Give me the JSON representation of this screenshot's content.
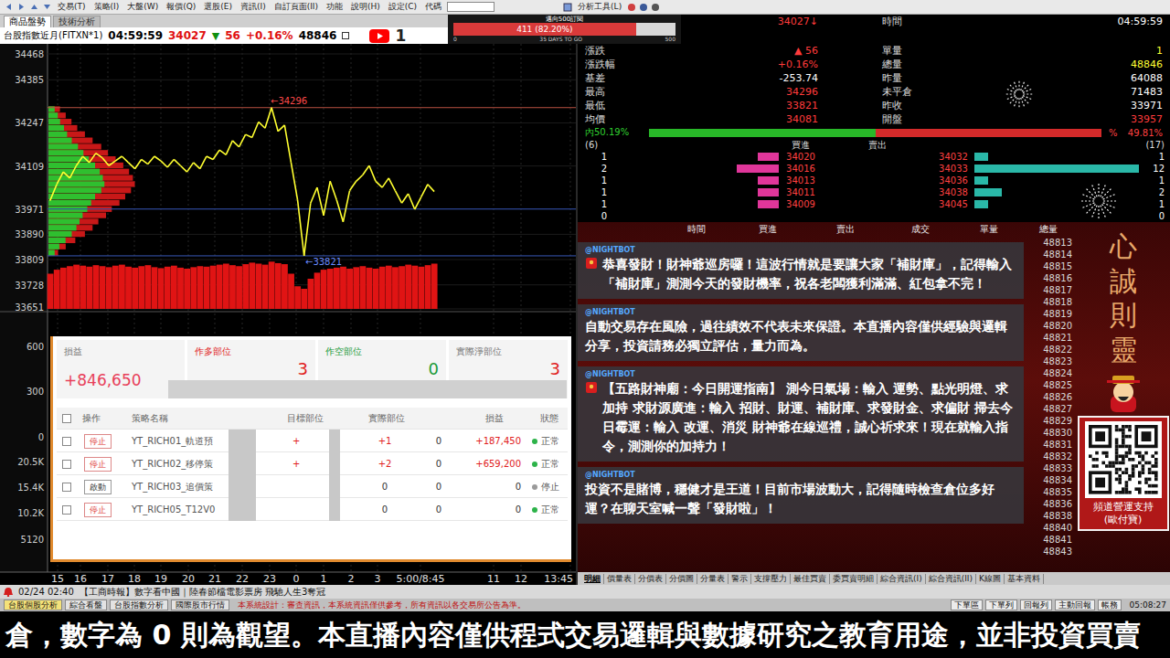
{
  "toolbar": {
    "menus": [
      "交易(T)",
      "策略(I)",
      "大盤(W)",
      "報價(Q)",
      "選股(E)",
      "資訊(I)",
      "自訂頁面(II)",
      "功能",
      "說明(H)",
      "設定(C)"
    ],
    "code_label": "代碼",
    "tool_menu": "分析工具(L)"
  },
  "subscribe_goal": {
    "title": "邁向500訂閱",
    "text": "411 (82.20%)",
    "level": 0.822,
    "min": "0",
    "mid": "35 DAYS TO GO",
    "max": "500"
  },
  "left_panel": {
    "tabs": [
      {
        "label": "商品盤勢",
        "selected": true
      },
      {
        "label": "技術分析",
        "selected": false
      }
    ],
    "quote_line": {
      "symbol": "台股指數近月(FITXN*1)",
      "time": "04:59:59",
      "price": "34027",
      "arrow": "▼",
      "change": "56",
      "pct": "+0.16%",
      "volume": "48846"
    },
    "youtube_count": "1"
  },
  "price_chart": {
    "y_max": 34468,
    "y_min": 33651,
    "y_ticks": [
      "34468",
      "34385",
      "34247",
      "34109",
      "33971",
      "33890",
      "33809",
      "33728",
      "33651"
    ],
    "series": [
      34000,
      34050,
      34090,
      34070,
      34110,
      34140,
      34120,
      34150,
      34135,
      34110,
      34125,
      34140,
      34120,
      34100,
      34130,
      34115,
      34140,
      34125,
      34105,
      34130,
      34110,
      34090,
      34120,
      34100,
      34140,
      34130,
      34160,
      34145,
      34190,
      34170,
      34210,
      34200,
      34250,
      34230,
      34296,
      34220,
      34240,
      34120,
      34000,
      33821,
      33990,
      34040,
      33950,
      34060,
      34000,
      33930,
      34030,
      34060,
      34080,
      34110,
      34060,
      34040,
      34070,
      34030,
      33990,
      34020,
      33970,
      34010,
      34050,
      34027
    ],
    "high_marker": {
      "label": "←34296",
      "value": 34296
    },
    "low_marker": {
      "label": "←33821",
      "value": 33821
    },
    "ref_line": 33971,
    "volume_profile": {
      "start": 34290,
      "step": 20,
      "buy": [
        8,
        12,
        15,
        20,
        24,
        30,
        38,
        45,
        52,
        60,
        66,
        70,
        72,
        68,
        60,
        55,
        50,
        44,
        40,
        36,
        30,
        22,
        14,
        8
      ],
      "sell": [
        12,
        18,
        24,
        30,
        38,
        46,
        55,
        62,
        70,
        78,
        84,
        88,
        90,
        86,
        80,
        74,
        66,
        60,
        52,
        46,
        38,
        28,
        18,
        10
      ]
    },
    "volume_bars": [
      70,
      78,
      82,
      85,
      88,
      86,
      84,
      87,
      85,
      83,
      86,
      88,
      84,
      82,
      85,
      87,
      83,
      81,
      84,
      86,
      82,
      80,
      83,
      85,
      84,
      86,
      88,
      90,
      87,
      85,
      89,
      92,
      90,
      88,
      94,
      91,
      89,
      70,
      45,
      40,
      60,
      72,
      78,
      80,
      82,
      84,
      80,
      83,
      85,
      82,
      80,
      84,
      86,
      83,
      85,
      88,
      86,
      84,
      87,
      90
    ]
  },
  "lower_chart": {
    "y_ticks": [
      "600",
      "300",
      "0",
      "20.5K",
      "15.4K",
      "10.2K",
      "5120"
    ]
  },
  "x_axis": [
    "15",
    "16",
    "17",
    "18",
    "19",
    "20",
    "21",
    "22",
    "23",
    "0",
    "1",
    "2",
    "3",
    "5:00/8:45",
    "11",
    "12",
    "13:45"
  ],
  "strategy_panel": {
    "summary": [
      {
        "label": "損益",
        "value": "+846,650",
        "color": "#e8405a",
        "label_color": "#777777"
      },
      {
        "label": "作多部位",
        "value": "3",
        "color": "#e02020",
        "label_color": "#e02020"
      },
      {
        "label": "作空部位",
        "value": "0",
        "color": "#1a9a3a",
        "label_color": "#1a9a3a"
      },
      {
        "label": "實際淨部位",
        "value": "3",
        "color": "#e02020",
        "label_color": "#777777"
      }
    ],
    "header_checked": false,
    "columns": [
      "",
      "操作",
      "策略名稱",
      "目標部位",
      "實際部位",
      "",
      "損益",
      "狀態"
    ],
    "rows": [
      {
        "checked": false,
        "kind": "stop",
        "action": "停止",
        "name": "YT_RICH01_軌道預",
        "target": "+",
        "actual": "+1",
        "extra": "0",
        "pnl": "+187,450",
        "status": "正常",
        "color": "#2db34a"
      },
      {
        "checked": false,
        "kind": "stop",
        "action": "停止",
        "name": "YT_RICH02_移停策",
        "target": "+",
        "actual": "+2",
        "extra": "0",
        "pnl": "+659,200",
        "status": "正常",
        "color": "#2db34a"
      },
      {
        "checked": false,
        "kind": "start",
        "action": "啟動",
        "name": "YT_RICH03_追價策",
        "target": "",
        "actual": "0",
        "extra": "0",
        "pnl": "0",
        "status": "停止",
        "color": "#9a9a9a"
      },
      {
        "checked": false,
        "kind": "stop",
        "action": "停止",
        "name": "YT_RICH05_T12V0",
        "target": "",
        "actual": "0",
        "extra": "0",
        "pnl": "0",
        "status": "正常",
        "color": "#2db34a"
      }
    ]
  },
  "quote_detail": {
    "left": [
      {
        "label": "",
        "value": "34027↓",
        "color": "#ff3b3b"
      },
      {
        "label": "漲跌",
        "value": "▲ 56",
        "color": "#ff3b3b"
      },
      {
        "label": "漲跌幅",
        "value": "+0.16%",
        "color": "#ff3b3b"
      },
      {
        "label": "基差",
        "value": "-253.74",
        "color": "#ffffff"
      },
      {
        "label": "最高",
        "value": "34296",
        "color": "#ff3b3b"
      },
      {
        "label": "最低",
        "value": "33821",
        "color": "#ff3b3b"
      },
      {
        "label": "均價",
        "value": "34081",
        "color": "#ff3b3b"
      }
    ],
    "right": [
      {
        "label": "時間",
        "value": "04:59:59",
        "color": "#ffffff"
      },
      {
        "label": "單量",
        "value": "1",
        "color": "#ffff33"
      },
      {
        "label": "總量",
        "value": "48846",
        "color": "#ffff33"
      },
      {
        "label": "昨量",
        "value": "64088",
        "color": "#ffffff"
      },
      {
        "label": "未平倉",
        "value": "71483",
        "color": "#ffffff"
      },
      {
        "label": "昨收",
        "value": "33971",
        "color": "#ffffff"
      },
      {
        "label": "開盤",
        "value": "33957",
        "color": "#ff3b3b"
      }
    ]
  },
  "inout": {
    "in_label": "內50.19%",
    "level": 0.5019,
    "pct_mark": "%",
    "out_label": "49.81%"
  },
  "order_book": {
    "bid_count": "(6)",
    "ask_count": "(17)",
    "bid_header": "買進",
    "ask_header": "賣出",
    "rows": [
      {
        "bid_qty": "1",
        "bid_level": 0.5,
        "bid_price": "34020",
        "ask_price": "34032",
        "ask_level": 0.083,
        "ask_qty": "1"
      },
      {
        "bid_qty": "2",
        "bid_level": 1,
        "bid_price": "34016",
        "ask_price": "34033",
        "ask_level": 1,
        "ask_qty": "12"
      },
      {
        "bid_qty": "1",
        "bid_level": 0.5,
        "bid_price": "34013",
        "ask_price": "34036",
        "ask_level": 0.083,
        "ask_qty": "1"
      },
      {
        "bid_qty": "1",
        "bid_level": 0.5,
        "bid_price": "34011",
        "ask_price": "34038",
        "ask_level": 0.167,
        "ask_qty": "2"
      },
      {
        "bid_qty": "1",
        "bid_level": 0.5,
        "bid_price": "34009",
        "ask_price": "34045",
        "ask_level": 0.083,
        "ask_qty": "1"
      }
    ],
    "bid_total": "0",
    "ask_total": "0"
  },
  "tick_table": {
    "columns": [
      "時間",
      "買進",
      "賣出",
      "成交",
      "單量",
      "總量"
    ],
    "totals": [
      "48813",
      "48814",
      "48815",
      "48816",
      "48817",
      "48818",
      "48819",
      "48820",
      "48821",
      "48822",
      "48823",
      "48824",
      "48825",
      "48826",
      "48827",
      "48829",
      "48830",
      "48831",
      "48832",
      "48833",
      "48834",
      "48835",
      "48836",
      "48838",
      "48840",
      "48841",
      "48843"
    ]
  },
  "chat": [
    {
      "author": "@NIGHTBOT",
      "kind": "promo",
      "text": "恭喜發財！財神爺巡房囉！這波行情就是要讓大家「補財庫」，記得輸入「補財庫」測測今天的發財機率，祝各老闆獲利滿滿、紅包拿不完！"
    },
    {
      "author": "@NIGHTBOT",
      "kind": "plain",
      "text": "自動交易存在風險，過往績效不代表未來保證。本直播內容僅供經驗與邏輯分享，投資請務必獨立評估，量力而為。"
    },
    {
      "author": "@NIGHTBOT",
      "kind": "promo",
      "text": "【五路財神廟：今日開運指南】 測今日氣場：輸入 運勢、點光明燈、求加持 求財源廣進：輸入 招財、財運、補財庫、求發財金、求偏財 掃去今日霉運：輸入 改運、消災 財神爺在線巡禮，誠心祈求來！現在就輸入指令，測測你的加持力！"
    },
    {
      "author": "@NIGHTBOT",
      "kind": "plain",
      "text": "投資不是賭博，穩健才是王道！目前市場波動大，記得隨時檢查倉位多好運？在聊天室喊一聲「發財啦」！"
    }
  ],
  "shrine": {
    "text": "心誠則靈"
  },
  "support": {
    "title": "頻道營運支持",
    "sub": "(歐付寶)"
  },
  "panel_tabs": [
    {
      "label": "明細",
      "selected": true
    },
    {
      "label": "價量表",
      "selected": false
    },
    {
      "label": "分價表",
      "selected": false
    },
    {
      "label": "分價圖",
      "selected": false
    },
    {
      "label": "分量表",
      "selected": false
    },
    {
      "label": "警示",
      "selected": false
    },
    {
      "label": "支撐壓力",
      "selected": false
    },
    {
      "label": "最佳買賣",
      "selected": false
    },
    {
      "label": "委買賣明細",
      "selected": false
    },
    {
      "label": "綜合資訊(I)",
      "selected": false
    },
    {
      "label": "綜合資訊(II)",
      "selected": false
    },
    {
      "label": "K線圖",
      "selected": false
    },
    {
      "label": "基本資料",
      "selected": false
    }
  ],
  "news": {
    "time": "02/24 02:40",
    "text": "【工商時報】數字看中國｜陸春節檔電影票房 飛馳人生3奪冠"
  },
  "workspace_tabs": [
    {
      "label": "台股個股分析",
      "selected": true
    },
    {
      "label": "綜合看盤",
      "selected": false
    },
    {
      "label": "台股指數分析",
      "selected": false
    },
    {
      "label": "國際股市行情",
      "selected": false
    }
  ],
  "notice": "本系統設計：審查資訊，本系統資訊僅供參考，所有資訊以各交易所公告為準。",
  "right_buttons": [
    "下單區",
    "下單列",
    "回報列",
    "主動回報",
    "帳務"
  ],
  "clock": "05:08:27",
  "marquee": "倉，數字為 0 則為觀望。本直播內容僅供程式交易邏輯與數據研究之教育用途，並非投資買賣"
}
